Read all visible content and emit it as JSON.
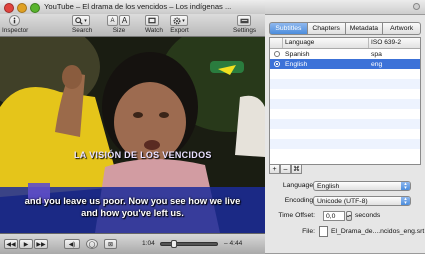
{
  "player": {
    "title": "YouTube – El drama de los vencidos – Los indígenas ...",
    "toolbar": [
      {
        "label": "Inspector",
        "icon": "info-icon"
      },
      {
        "label": "Search",
        "icon": "search-icon"
      },
      {
        "label": "Size",
        "icon": "font-size-icon",
        "buttons": [
          "A",
          "A"
        ]
      },
      {
        "label": "Watch",
        "icon": "film-icon"
      },
      {
        "label": "Export",
        "icon": "gear-icon"
      },
      {
        "label": "Settings",
        "icon": "keyboard-icon"
      }
    ],
    "video": {
      "overlay_caption": "LA VISIÓN DE LOS VENCIDOS",
      "subtitle_lines": [
        "and you leave us poor. Now you see how we live",
        "and how you've left us."
      ]
    },
    "controls": {
      "current_time": "1:04",
      "remaining_time": "– 4:44",
      "progress_fraction": 0.2
    }
  },
  "panel": {
    "tabs": [
      "Subtitles",
      "Chapters",
      "Metadata",
      "Artwork"
    ],
    "active_tab": 0,
    "table": {
      "columns": [
        "Language",
        "ISO 639-2"
      ],
      "rows": [
        {
          "language": "Spanish",
          "code": "spa",
          "selected": false
        },
        {
          "language": "English",
          "code": "eng",
          "selected": true
        }
      ]
    },
    "table_buttons": [
      "+",
      "–",
      "⌘"
    ],
    "form": {
      "language_label": "Language:",
      "language_value": "English",
      "encoding_label": "Encoding:",
      "encoding_value": "Unicode (UTF-8)",
      "time_offset_label": "Time Offset:",
      "time_offset_value": "0,0",
      "time_offset_unit": "seconds",
      "file_label": "File:",
      "file_value": "El_Drama_de....ncidos_eng.srt"
    }
  },
  "colors": {
    "selection": "#3c72d8",
    "tab_active": "#4c8ddd",
    "close_light": "#e0443e",
    "minimize_light": "#dfa123",
    "zoom_light": "#59b42d"
  }
}
